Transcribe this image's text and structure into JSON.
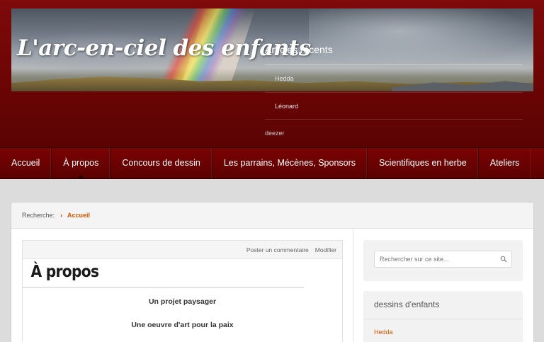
{
  "header": {
    "site_title": "L'arc-en-ciel des enfants",
    "recent_posts": {
      "title": "Articles récents",
      "items": [
        "Hedda",
        "Léonard",
        "deezer"
      ]
    }
  },
  "nav": {
    "items": [
      "Accueil",
      "À propos",
      "Concours de dessin",
      "Les parrains, Mécènes, Sponsors",
      "Scientifiques en herbe",
      "Ateliers"
    ]
  },
  "breadcrumb": {
    "label": "Recherche:",
    "separator": "›",
    "current": "Accueil"
  },
  "post": {
    "actions": [
      "Poster un commentaire",
      "Modifier"
    ],
    "title": "À propos",
    "lines": [
      "Un projet paysager",
      "Une oeuvre d'art pour la paix"
    ]
  },
  "sidebar": {
    "search_placeholder": "Rechercher sur ce site...",
    "widget_title": "dessins d'enfants",
    "widget_link": "Hedda"
  },
  "colors": {
    "header_red": "#6d0505",
    "accent_orange": "#d45500",
    "page_bg": "#dcdcdc"
  }
}
